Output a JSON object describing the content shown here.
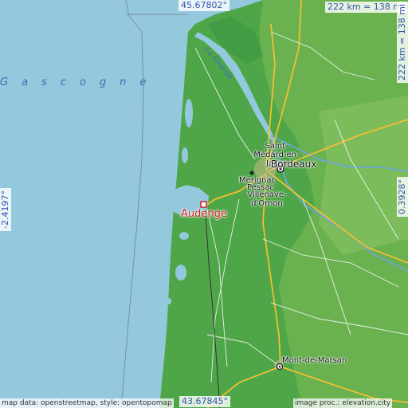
{
  "coords": {
    "north": "45.67802°",
    "south": "43.67845°",
    "west": "-2.4197°",
    "east": "0.3928°"
  },
  "scale": {
    "top": "222 km = 138 mi",
    "right": "222 km = 138 mi"
  },
  "labels": {
    "sea": "Gascogne",
    "river": "La Gironde",
    "main_city": "Audenge",
    "cities": [
      "Saint-Médard-en-Jalles",
      "Bordeaux",
      "Mérignac",
      "Pessac",
      "Villenave-d'Ornon",
      "Mont-de-Marsan"
    ]
  },
  "attribution": {
    "left": "map data: openstreetmap, style: opentopomap",
    "right": "image proc.: elevation.city"
  },
  "colors": {
    "sea": "#93c8dd",
    "lowland": "#4fa648",
    "inland": "#6fb352",
    "coord_text": "#3355aa",
    "marker": "#cc2222"
  },
  "icons": {
    "marker": "square-marker-icon",
    "city": "city-dot-icon"
  }
}
